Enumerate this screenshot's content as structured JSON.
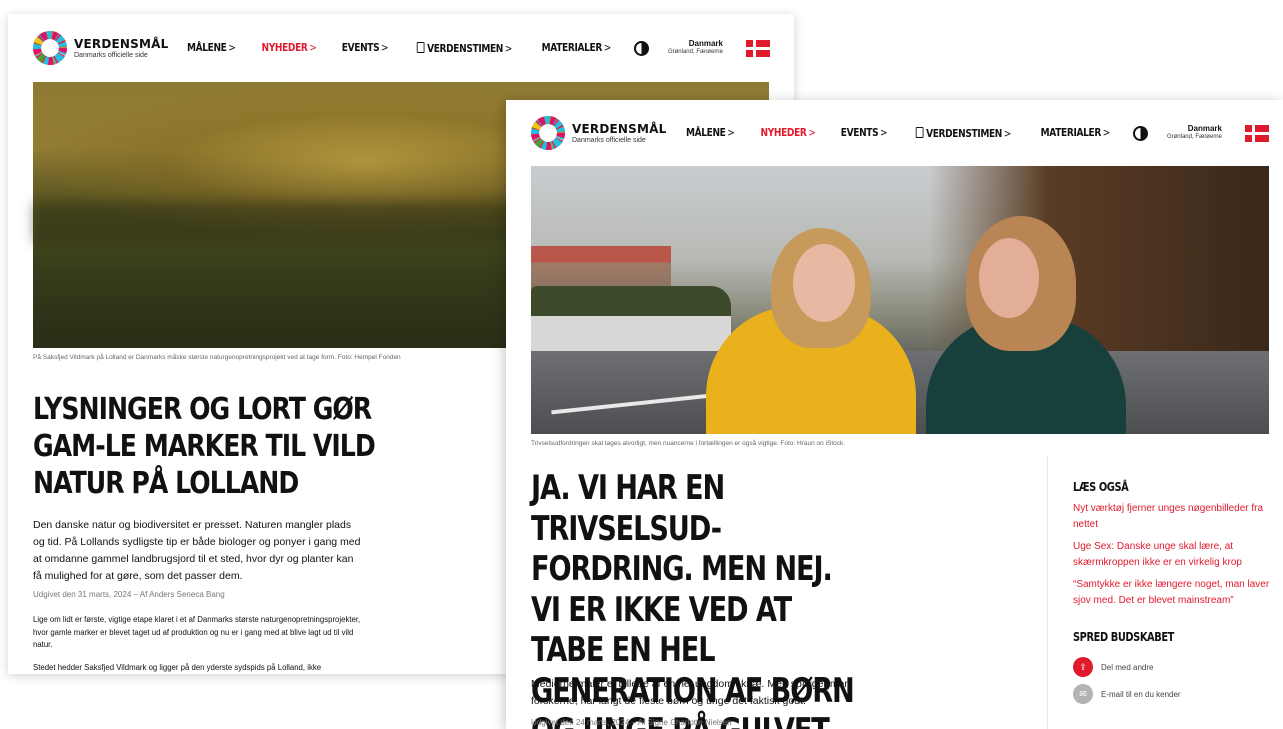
{
  "colors": {
    "accent": "#e01a2d",
    "text": "#111111",
    "muted": "#777777"
  },
  "brand": {
    "title": "VERDENSMÅL",
    "subtitle": "Danmarks officielle side"
  },
  "nav": {
    "items": [
      "MÅLENE",
      "NYHEDER",
      "EVENTS",
      "VERDENSTIMEN",
      "MATERIALER"
    ],
    "chevron": ">",
    "active": "NYHEDER"
  },
  "country": {
    "name": "Danmark",
    "sub": "Grønland, Færøerne"
  },
  "back_article": {
    "caption": "På Saksfjed Vildmark på Lolland er Danmarks måske største naturgenopretningsprojekt ved at tage form. Foto: Hempel Fonden",
    "title": "LYSNINGER OG LORT GØR GAM-LE MARKER TIL VILD NATUR PÅ LOLLAND",
    "lead": "Den danske natur og biodiversitet er presset. Naturen mangler plads og tid. På Lollands sydligste tip er både biologer og ponyer i gang med at omdanne gammel landbrugsjord til et sted, hvor dyr og planter kan få mulighed for at gøre, som det passer dem.",
    "meta": "Udgivet den 31 marts, 2024 – Af Anders Seneca Bang",
    "p1": "Lige om lidt er første, vigtige etape klaret i et af Danmarks største naturgenopretningsprojekter, hvor gamle marker er blevet taget ud af produktion og nu er i gang med at blive lagt ud til vild natur.",
    "p2": "Stedet hedder Saksfjed Vildmark og ligger på den yderste sydspids på Lolland, ikke"
  },
  "front_article": {
    "caption": "Trivselsudfordringen skal tages alvorligt, men nuancerne i fortællingen er også vigtige. Foto: Hraun on iStock.",
    "title": "JA. VI HAR EN TRIVSELSUD-FORDRING. MEN NEJ. VI ER IKKE VED AT TABE EN HEL GENERATION AF BØRN OG UNGE PÅ GULVET.",
    "lead": "Medierne maler et billede af en hel ungdom i knæ. Men spørger man forskerne, har langt de fleste børn og unge det faktisk godt.",
    "meta": "Udgivet den 24 marts, 2024 – Af Signe Charlotte Nielsen"
  },
  "sidebar": {
    "read_also_heading": "LÆS OGSÅ",
    "related": [
      "Nyt værktøj fjerner unges nøgenbilleder fra nettet",
      "Uge Sex: Danske unge skal lære, at skærmkroppen ikke er en virkelig krop",
      "“Samtykke er ikke længere noget, man laver sjov med. Det er blevet mainstream”"
    ],
    "share_heading": "SPRED BUDSKABET",
    "share": [
      {
        "label": "Del med andre",
        "icon": "share-icon"
      },
      {
        "label": "E-mail til en du kender",
        "icon": "mail-icon"
      }
    ]
  }
}
